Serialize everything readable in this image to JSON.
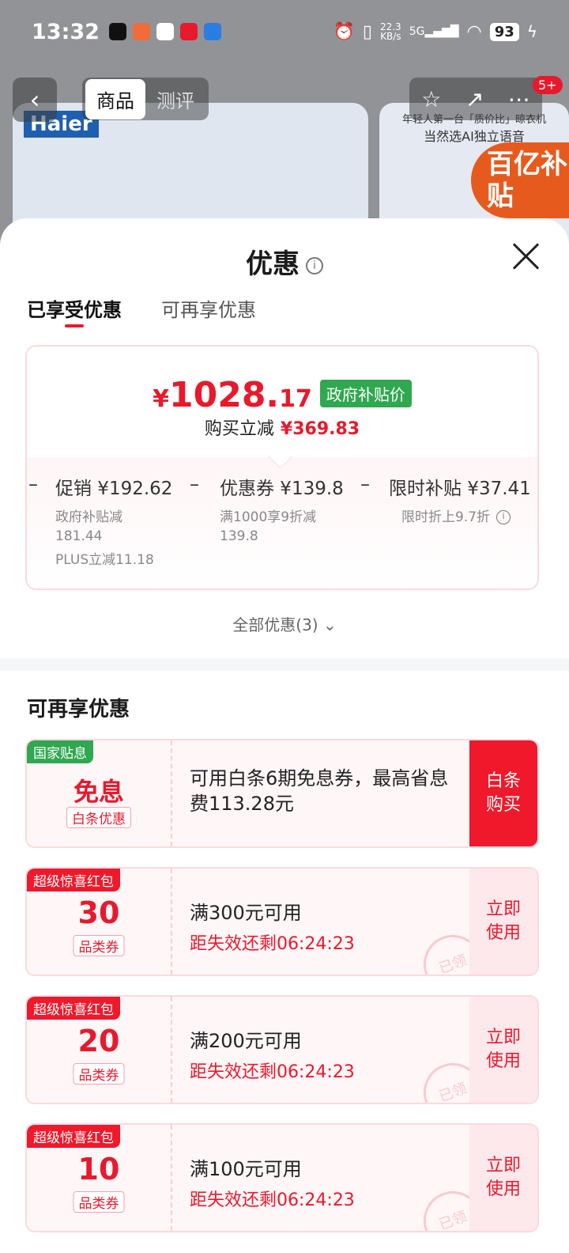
{
  "status_bar": {
    "time": "13:32",
    "net_speed_value": "22.3",
    "net_speed_unit": "KB/s",
    "network": "5G",
    "battery": "93"
  },
  "background": {
    "tabs": [
      "商品",
      "测评"
    ],
    "badge": "5+",
    "brand": "Haier",
    "side_text_1": "年轻人第一台「质价比」晾衣机",
    "side_text_2": "当然选AI独立语音",
    "subsidy_text": "百亿补贴"
  },
  "sheet": {
    "title": "优惠",
    "tabs": [
      {
        "label": "已享受优惠",
        "active": true
      },
      {
        "label": "可再享优惠",
        "active": false
      }
    ],
    "summary": {
      "currency": "¥",
      "price_int": "1028.",
      "price_dec": "17",
      "price_badge": "政府补贴价",
      "save_label": "购买立减",
      "save_amount": "¥369.83",
      "breakdown": [
        {
          "label": "促销 ¥192.62",
          "subs": [
            "政府补贴减",
            "181.44",
            "PLUS立减11.18"
          ]
        },
        {
          "label": "优惠券 ¥139.8",
          "subs": [
            "满1000享9折减",
            "139.8"
          ]
        },
        {
          "label": "限时补贴 ¥37.41",
          "subs": [
            "限时折上9.7折"
          ]
        }
      ],
      "minus": "–"
    },
    "all_offers": "全部优惠(3)",
    "section_title": "可再享优惠",
    "coupons": [
      {
        "tag": "国家贴息",
        "tag_color": "#2fa84f",
        "big": "免息",
        "small": "白条优惠",
        "desc": "可用白条6期免息券，最高省息费113.28元",
        "button": "白条购买",
        "primary": true
      },
      {
        "tag": "超级惊喜红包",
        "tag_color": "#f0182b",
        "big": "30",
        "small": "品类券",
        "line1": "满300元可用",
        "line2": "距失效还剩06:24:23",
        "button": "立即使用",
        "stamp": "已领"
      },
      {
        "tag": "超级惊喜红包",
        "tag_color": "#f0182b",
        "big": "20",
        "small": "品类券",
        "line1": "满200元可用",
        "line2": "距失效还剩06:24:23",
        "button": "立即使用",
        "stamp": "已领"
      },
      {
        "tag": "超级惊喜红包",
        "tag_color": "#f0182b",
        "big": "10",
        "small": "品类券",
        "line1": "满100元可用",
        "line2": "距失效还剩06:24:23",
        "button": "立即使用",
        "stamp": "已领"
      }
    ]
  }
}
